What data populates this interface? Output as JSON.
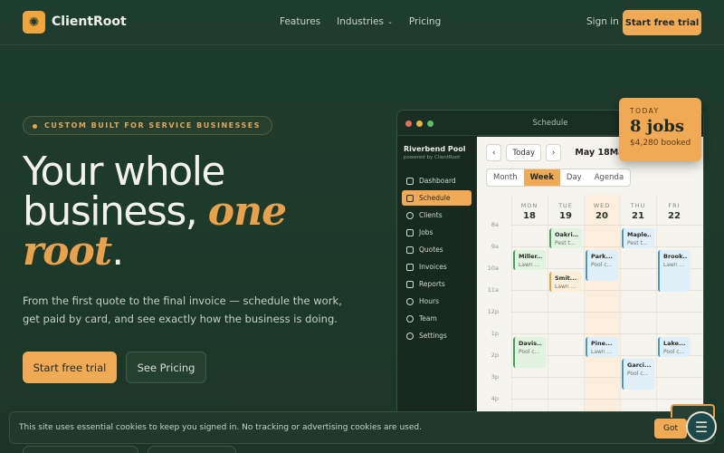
{
  "nav": {
    "brand": "ClientRoot",
    "links": [
      "Features",
      "Industries",
      "Pricing"
    ],
    "signin": "Sign in",
    "cta": "Start free trial"
  },
  "hero": {
    "pill": "CUSTOM BUILT FOR SERVICE BUSINESSES",
    "line1": "Your whole",
    "line2a": "business,",
    "line2b": "one",
    "line3a": "root",
    "line3b": ".",
    "lead": "From the first quote to the final invoice — schedule the work, get paid by card, and see exactly how the business is doing.",
    "primary": "Start free trial",
    "secondary": "See Pricing"
  },
  "app": {
    "title": "Schedule",
    "workspace": "Riverbend Pool",
    "workspace_sub": "powered by ClientRoot",
    "menu": [
      "Dashboard",
      "Schedule",
      "Clients",
      "Jobs",
      "Quotes",
      "Invoices",
      "Reports",
      "Hours",
      "Team",
      "Settings"
    ],
    "today_btn": "Today",
    "prev": "‹",
    "next": "›",
    "range": "May 18May",
    "views": [
      "Month",
      "Week",
      "Day",
      "Agenda"
    ],
    "days": [
      {
        "n": "MON",
        "d": "18"
      },
      {
        "n": "TUE",
        "d": "19"
      },
      {
        "n": "WED",
        "d": "20"
      },
      {
        "n": "THU",
        "d": "21"
      },
      {
        "n": "FRI",
        "d": "22"
      }
    ],
    "hours": [
      "8a",
      "9a",
      "10a",
      "11a",
      "12p",
      "1p",
      "2p",
      "3p",
      "4p"
    ],
    "events": [
      {
        "t": "Oakri...",
        "s": "Pest t...",
        "c": "green"
      },
      {
        "t": "Maple...",
        "s": "Pest t...",
        "c": "blue"
      },
      {
        "t": "Miller...",
        "s": "Lawn ...",
        "c": "green"
      },
      {
        "t": "Park...",
        "s": "Pool c...",
        "c": "blue"
      },
      {
        "t": "Brook...",
        "s": "Lawn ...",
        "c": "blue"
      },
      {
        "t": "Smit...",
        "s": "Lawn ...",
        "c": "orange"
      },
      {
        "t": "Davis...",
        "s": "Pool c...",
        "c": "green"
      },
      {
        "t": "Pine...",
        "s": "Lawn ...",
        "c": "blue"
      },
      {
        "t": "Lake...",
        "s": "Pool c...",
        "c": "blue"
      },
      {
        "t": "Garci...",
        "s": "Pool c...",
        "c": "blue"
      }
    ]
  },
  "today": {
    "label": "TODAY",
    "value": "8 jobs",
    "booked": "$4,280 booked"
  },
  "cookie": {
    "text": "This site uses essential cookies to keep you signed in. No tracking or advertising cookies are used.",
    "button": "Got"
  }
}
